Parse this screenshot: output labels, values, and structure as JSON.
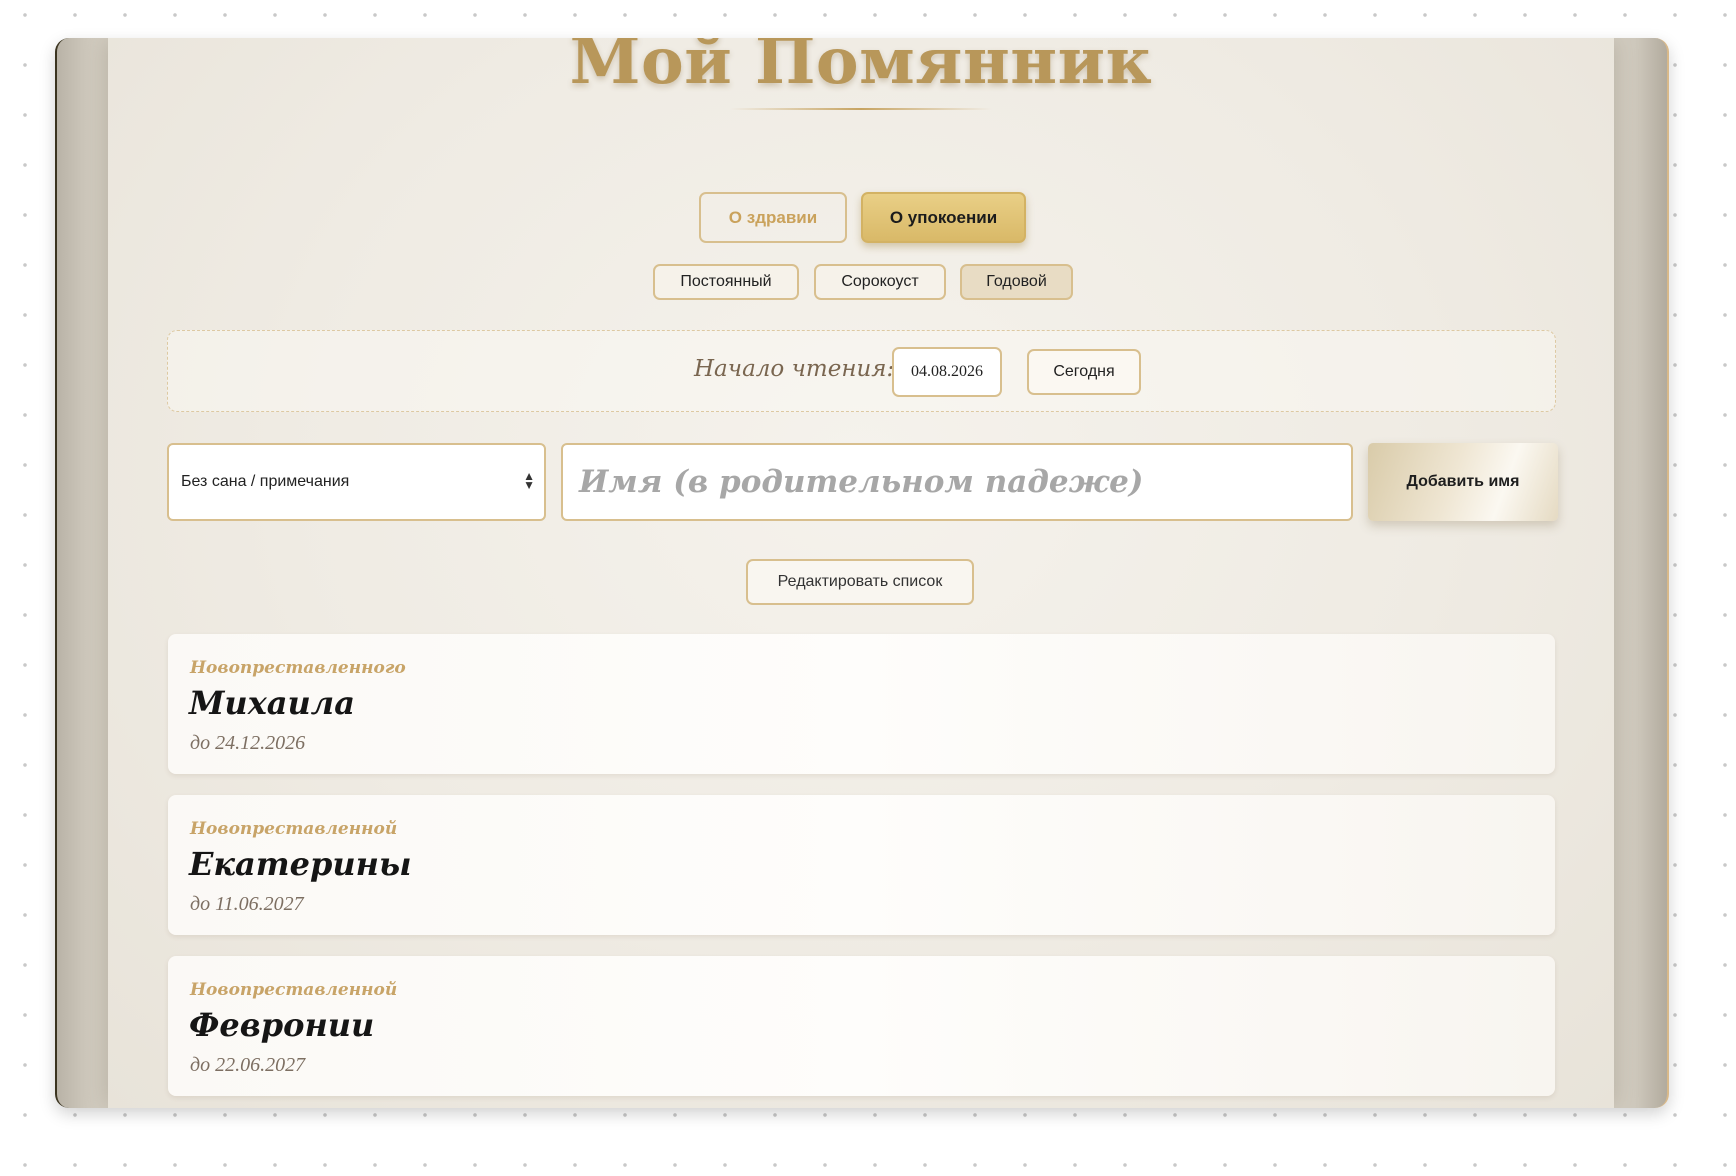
{
  "app": {
    "title": "Мой Помянник"
  },
  "tabs": {
    "health_label": "О здравии",
    "repose_label": "О упокоении",
    "active": "repose"
  },
  "subtypes": {
    "items": [
      "Постоянный",
      "Сорокоуст",
      "Годовой"
    ],
    "active": "Годовой"
  },
  "start": {
    "label": "Начало чтения:",
    "date_value": "04.08.2026",
    "today_label": "Сегодня"
  },
  "add_form": {
    "rank_select_value": "Без сана / примечания",
    "name_placeholder": "Имя (в родительном падеже)",
    "add_label": "Добавить имя"
  },
  "edit_label": "Редактировать список",
  "entries": [
    {
      "rank": "Новопреставленного",
      "name": "Михаила",
      "until": "до 24.12.2026"
    },
    {
      "rank": "Новопреставленной",
      "name": "Екатерины",
      "until": "до 11.06.2027"
    },
    {
      "rank": "Новопреставленной",
      "name": "Февронии",
      "until": "до 22.06.2027"
    }
  ],
  "colors": {
    "gold": "#b8975a",
    "accent_border": "#d8bf8e",
    "active_tab": "#dfc173"
  }
}
